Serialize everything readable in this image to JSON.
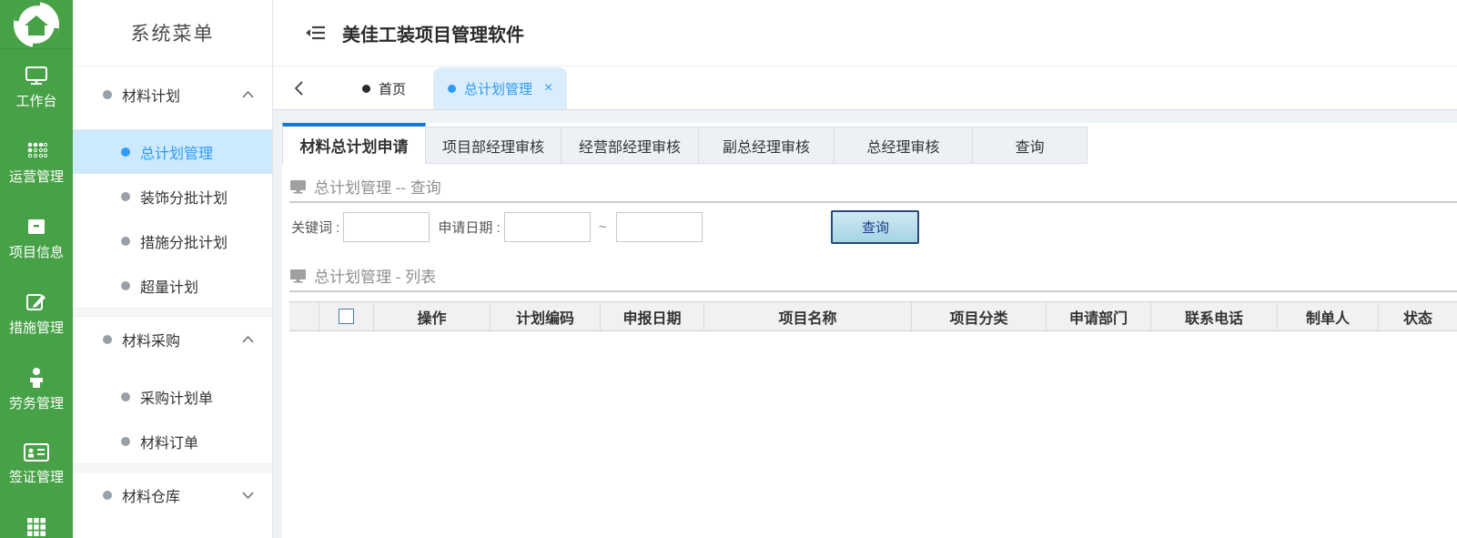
{
  "rail": {
    "items": [
      {
        "label": "工作台",
        "icon": "monitor-icon"
      },
      {
        "label": "运营管理",
        "icon": "apps-dots-icon"
      },
      {
        "label": "项目信息",
        "icon": "archive-box-icon"
      },
      {
        "label": "措施管理",
        "icon": "edit-icon"
      },
      {
        "label": "劳务管理",
        "icon": "person-icon"
      },
      {
        "label": "签证管理",
        "icon": "id-card-icon"
      },
      {
        "label": "",
        "icon": "grid-icon"
      }
    ]
  },
  "menu": {
    "title": "系统菜单",
    "items": [
      {
        "label": "材料计划",
        "level": "group",
        "state": "expanded"
      },
      {
        "label": "总计划管理",
        "level": "sub",
        "selected": true
      },
      {
        "label": "装饰分批计划",
        "level": "sub"
      },
      {
        "label": "措施分批计划",
        "level": "sub"
      },
      {
        "label": "超量计划",
        "level": "sub"
      },
      {
        "label": "材料采购",
        "level": "group",
        "state": "expanded"
      },
      {
        "label": "采购计划单",
        "level": "sub"
      },
      {
        "label": "材料订单",
        "level": "sub"
      },
      {
        "label": "材料仓库",
        "level": "group",
        "state": "collapsed"
      }
    ]
  },
  "header": {
    "app_title": "美佳工装项目管理软件"
  },
  "tabbar": {
    "tabs": [
      {
        "label": "首页",
        "active": false
      },
      {
        "label": "总计划管理",
        "active": true
      }
    ],
    "close_glyph": "×"
  },
  "main": {
    "tabs": [
      {
        "label": "材料总计划申请",
        "active": true
      },
      {
        "label": "项目部经理审核"
      },
      {
        "label": "经营部经理审核"
      },
      {
        "label": "副总经理审核"
      },
      {
        "label": "总经理审核"
      },
      {
        "label": "查询"
      }
    ],
    "query": {
      "section_title": "总计划管理 -- 查询",
      "keyword_label": "关键词 :",
      "keyword_value": "",
      "date_label": "申请日期 :",
      "date_from": "",
      "date_to": "",
      "range_separator": "~",
      "search_button": "查询"
    },
    "list": {
      "section_title": "总计划管理 - 列表",
      "columns": [
        "操作",
        "计划编码",
        "申报日期",
        "项目名称",
        "项目分类",
        "申请部门",
        "联系电话",
        "制单人",
        "状态"
      ],
      "rows": []
    }
  },
  "colors": {
    "sidebar_green": "#47a247",
    "accent_blue": "#2e9cf5",
    "active_tab_bg": "#d9edfc",
    "doc_tab_topbar": "#1878c8",
    "search_button_bg": "#aedbe9",
    "search_button_border": "#29487e"
  }
}
